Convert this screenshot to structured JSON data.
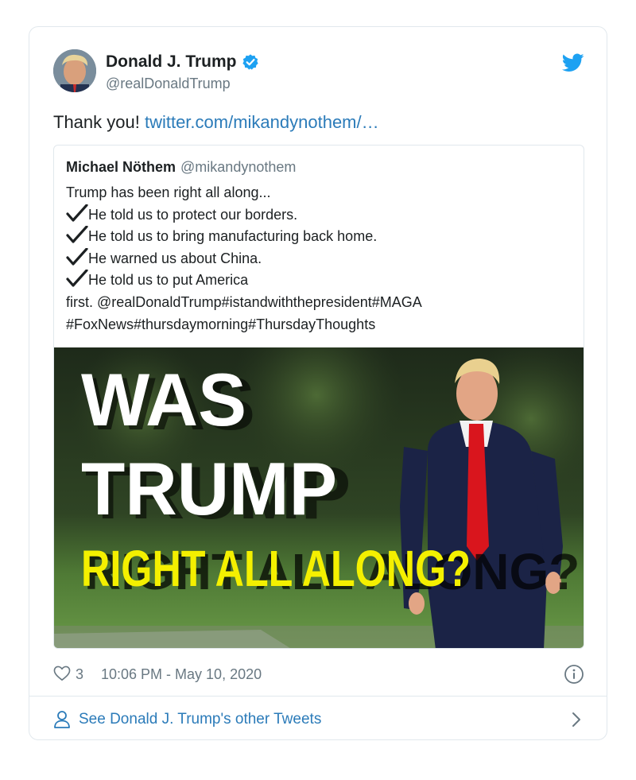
{
  "tweet": {
    "author_name": "Donald J. Trump",
    "author_handle": "@realDonaldTrump",
    "text": "Thank you! ",
    "link_text": "twitter.com/mikandynothem/…",
    "likes": "3",
    "timestamp": "10:06 PM - May 10, 2020",
    "see_more": "See Donald J. Trump's other Tweets"
  },
  "quoted": {
    "author_name": "Michael Nöthem",
    "author_handle": "@mikandynothem",
    "lines": [
      "Trump has been right all along...",
      "He told us to protect our borders.",
      "He told us to bring manufacturing back home.",
      "He warned us about China.",
      "He told us to put America",
      "first. @realDonaldTrump#istandwiththepresident#MAGA",
      "#FoxNews#thursdaymorning#ThursdayThoughts"
    ],
    "image": {
      "line1": "WAS",
      "line2": "TRUMP",
      "line3": "RIGHT ALL ALONG?"
    }
  },
  "icons": {
    "verified": "verified-badge-icon",
    "bird": "twitter-bird-icon",
    "heart": "heart-icon",
    "info": "info-icon",
    "person": "person-icon",
    "chevron": "chevron-right-icon",
    "check": "checkmark-icon"
  },
  "colors": {
    "link": "#2b7bb9",
    "verified": "#1da1f2",
    "text": "#1c2022",
    "muted": "#697882",
    "border": "#e1e8ed",
    "headline_white": "#ffffff",
    "headline_yellow": "#f4f000"
  }
}
